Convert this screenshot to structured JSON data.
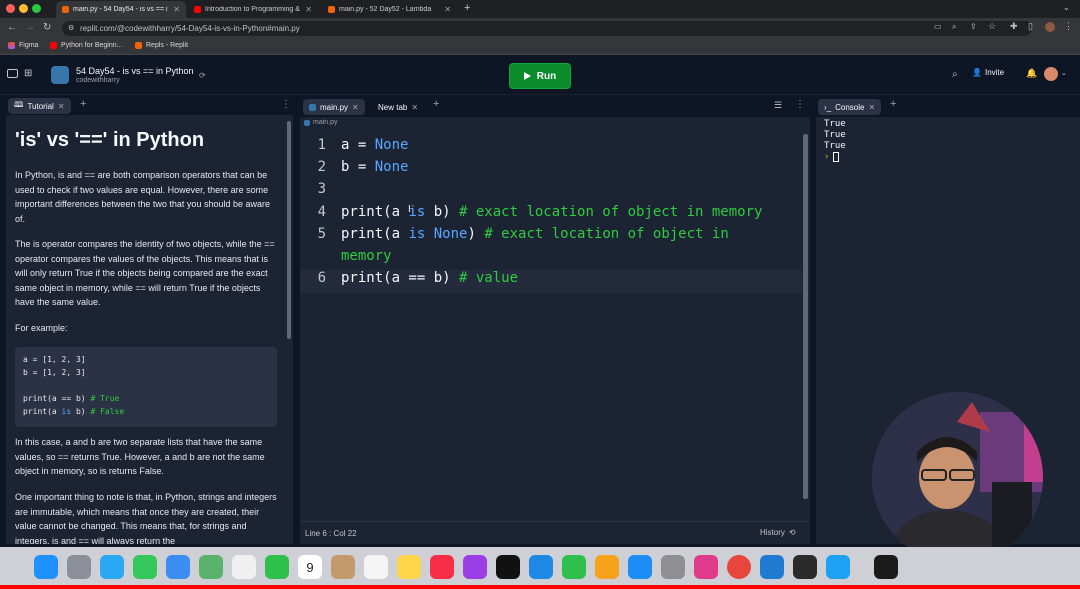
{
  "browser": {
    "tabs": [
      {
        "title": "main.py - 54 Day54 - is vs == i",
        "active": true
      },
      {
        "title": "Introduction to Programming &",
        "active": false
      },
      {
        "title": "main.py - 52 Day52 - Lambda",
        "active": false
      }
    ],
    "url": "replit.com/@codewithharry/54-Day54-is-vs-in-Python#main.py",
    "bookmarks": [
      "Figma",
      "Python for Beginn...",
      "Repls - Replit"
    ]
  },
  "app": {
    "repl_name": "54 Day54 - is vs == in Python",
    "owner": "codewithharry",
    "run_label": "Run",
    "invite_label": "Invite"
  },
  "tutorial": {
    "tab_label": "Tutorial",
    "heading": "'is' vs '==' in Python",
    "paragraphs": [
      "In Python, is and == are both comparison operators that can be used to check if two values are equal. However, there are some important differences between the two that you should be aware of.",
      "The is operator compares the identity of two objects, while the == operator compares the values of the objects. This means that is will only return True if the objects being compared are the exact same object in memory, while == will return True if the objects have the same value.",
      "For example:",
      "In this case, a and b are two separate lists that have the same values, so == returns True. However, a and b are not the same object in memory, so is returns False.",
      "One important thing to note is that, in Python, strings and integers are immutable, which means that once they are created, their value cannot be changed. This means that, for strings and integers, is and == will always return the"
    ],
    "example_code": {
      "line1": "a = [1, 2, 3]",
      "line2": "b = [1, 2, 3]",
      "line3a": "print(a == b)",
      "line3b": "# True",
      "line4a": "print(a ",
      "line4kw": "is",
      "line4b": " b)",
      "line4c": "# False"
    }
  },
  "editor": {
    "tabs": [
      "main.py",
      "New tab"
    ],
    "breadcrumb": "main.py",
    "lines": [
      {
        "n": "1",
        "parts": [
          [
            "a = ",
            ""
          ],
          [
            "None",
            "kw"
          ]
        ]
      },
      {
        "n": "2",
        "parts": [
          [
            "b = ",
            ""
          ],
          [
            "None",
            "kw"
          ]
        ]
      },
      {
        "n": "3",
        "parts": []
      },
      {
        "n": "4",
        "parts": [
          [
            "print(a ",
            ""
          ],
          [
            "is",
            "kw"
          ],
          [
            " b) ",
            ""
          ],
          [
            "# exact location of object in memory",
            "cm"
          ]
        ]
      },
      {
        "n": "5",
        "parts": [
          [
            "print(a ",
            ""
          ],
          [
            "is",
            "kw"
          ],
          [
            " ",
            ""
          ],
          [
            "None",
            "kw"
          ],
          [
            ") ",
            ""
          ],
          [
            "# exact location of object in",
            "cm"
          ]
        ]
      },
      {
        "n": "",
        "parts": [
          [
            "memory",
            "cm"
          ]
        ]
      },
      {
        "n": "6",
        "parts": [
          [
            "print(a == b) ",
            ""
          ],
          [
            "# value",
            "cm"
          ]
        ]
      }
    ],
    "status_position": "Line 6 : Col 22",
    "history_label": "History"
  },
  "console": {
    "tab_label": "Console",
    "output": [
      "True",
      "True",
      "True"
    ],
    "prompt": "›"
  },
  "colors": {
    "run_green": "#0a8c2a",
    "keyword_blue": "#58a6ff",
    "comment_green": "#2ecc40",
    "panel_bg": "#1c2333"
  }
}
